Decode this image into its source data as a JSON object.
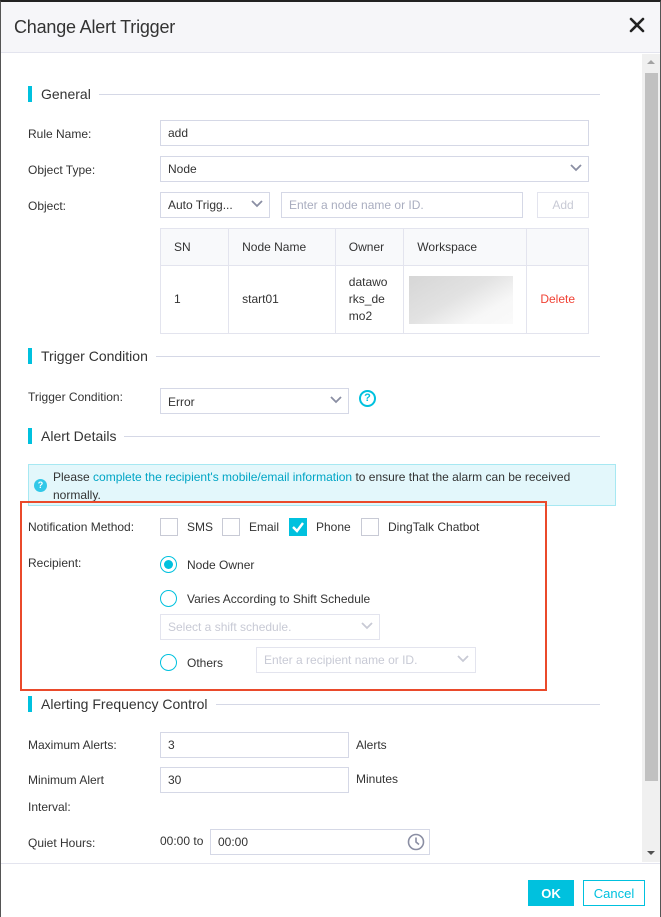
{
  "dialog": {
    "title": "Change Alert Trigger",
    "close_icon": "close-icon"
  },
  "general": {
    "section_title": "General",
    "rule_name": {
      "label": "Rule Name:",
      "value": "add"
    },
    "object_type": {
      "label": "Object Type:",
      "value": "Node"
    },
    "object": {
      "label": "Object:",
      "mode_value": "Auto Trigg...",
      "search_placeholder": "Enter a node name or ID.",
      "add_label": "Add"
    },
    "table": {
      "columns": [
        "SN",
        "Node Name",
        "Owner",
        "Workspace",
        ""
      ],
      "rows": [
        {
          "sn": "1",
          "node_name": "start01",
          "owner": "dataworks_demo2",
          "workspace": "",
          "action": "Delete"
        }
      ]
    }
  },
  "trigger": {
    "section_title": "Trigger Condition",
    "label": "Trigger Condition:",
    "value": "Error",
    "help_icon": "help-icon"
  },
  "alert_details": {
    "section_title": "Alert Details",
    "notice": {
      "prefix": "Please ",
      "link": "complete the recipient's mobile/email information",
      "suffix": " to ensure that the alarm can be received normally."
    },
    "notification_method": {
      "label": "Notification Method:",
      "options": [
        {
          "label": "SMS",
          "checked": false
        },
        {
          "label": "Email",
          "checked": false
        },
        {
          "label": "Phone",
          "checked": true
        },
        {
          "label": "DingTalk Chatbot",
          "checked": false
        }
      ]
    },
    "recipient": {
      "label": "Recipient:",
      "options": [
        {
          "label": "Node Owner",
          "selected": true
        },
        {
          "label": "Varies According to Shift Schedule",
          "selected": false
        },
        {
          "label": "Others",
          "selected": false
        }
      ],
      "shift_placeholder": "Select a shift schedule.",
      "others_placeholder": "Enter a recipient name or ID."
    }
  },
  "frequency": {
    "section_title": "Alerting Frequency Control",
    "max_alerts": {
      "label": "Maximum Alerts:",
      "value": "3",
      "unit": "Alerts"
    },
    "min_interval": {
      "label_line1": "Minimum Alert",
      "label_line2": "Interval:",
      "value": "30",
      "unit": "Minutes"
    },
    "quiet_hours": {
      "label": "Quiet Hours:",
      "start": "00:00 to",
      "end": "00:00"
    }
  },
  "footer": {
    "ok_label": "OK",
    "cancel_label": "Cancel"
  },
  "colors": {
    "accent": "#00c1de",
    "danger": "#f04134",
    "highlight_border": "#ea4a2b"
  }
}
